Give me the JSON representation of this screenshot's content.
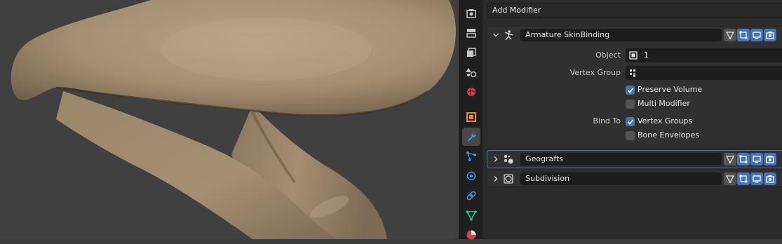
{
  "properties": {
    "add_modifier_label": "Add Modifier",
    "tabs": [
      {
        "name": "render-tab-icon",
        "color": "#c9c9c9"
      },
      {
        "name": "output-tab-icon",
        "color": "#c9c9c9"
      },
      {
        "name": "view-layer-tab-icon",
        "color": "#c9c9c9"
      },
      {
        "name": "scene-tab-icon",
        "color": "#c9c9c9"
      },
      {
        "name": "world-tab-icon",
        "color": "#d0463f"
      },
      {
        "name": "object-tab-icon",
        "color": "#f08c28"
      },
      {
        "name": "modifier-tab-icon",
        "color": "#4d8ee6",
        "active": true
      },
      {
        "name": "particles-tab-icon",
        "color": "#4d8ee6"
      },
      {
        "name": "physics-tab-icon",
        "color": "#4d8ee6"
      },
      {
        "name": "constraints-tab-icon",
        "color": "#4d8ee6"
      },
      {
        "name": "data-tab-icon",
        "color": "#2fc08b"
      },
      {
        "name": "material-tab-icon",
        "color": "#d0463f"
      }
    ],
    "modifiers": [
      {
        "name": "Armature SkinBinding",
        "icon": "armature-modifier-icon",
        "expanded": true,
        "object_label": "Object",
        "object_value": "1",
        "vertex_group_label": "Vertex Group",
        "vertex_group_value": "",
        "preserve_volume_label": "Preserve Volume",
        "preserve_volume": true,
        "multi_modifier_label": "Multi Modifier",
        "multi_modifier": false,
        "bind_to_label": "Bind To",
        "vertex_groups_label": "Vertex Groups",
        "vertex_groups": true,
        "bone_envelopes_label": "Bone Envelopes",
        "bone_envelopes": false
      },
      {
        "name": "Geografts",
        "icon": "geometry-nodes-modifier-icon",
        "expanded": false,
        "selected": true
      },
      {
        "name": "Subdivision",
        "icon": "subdivision-modifier-icon",
        "expanded": false
      }
    ],
    "accent_color": "#4772b3"
  }
}
